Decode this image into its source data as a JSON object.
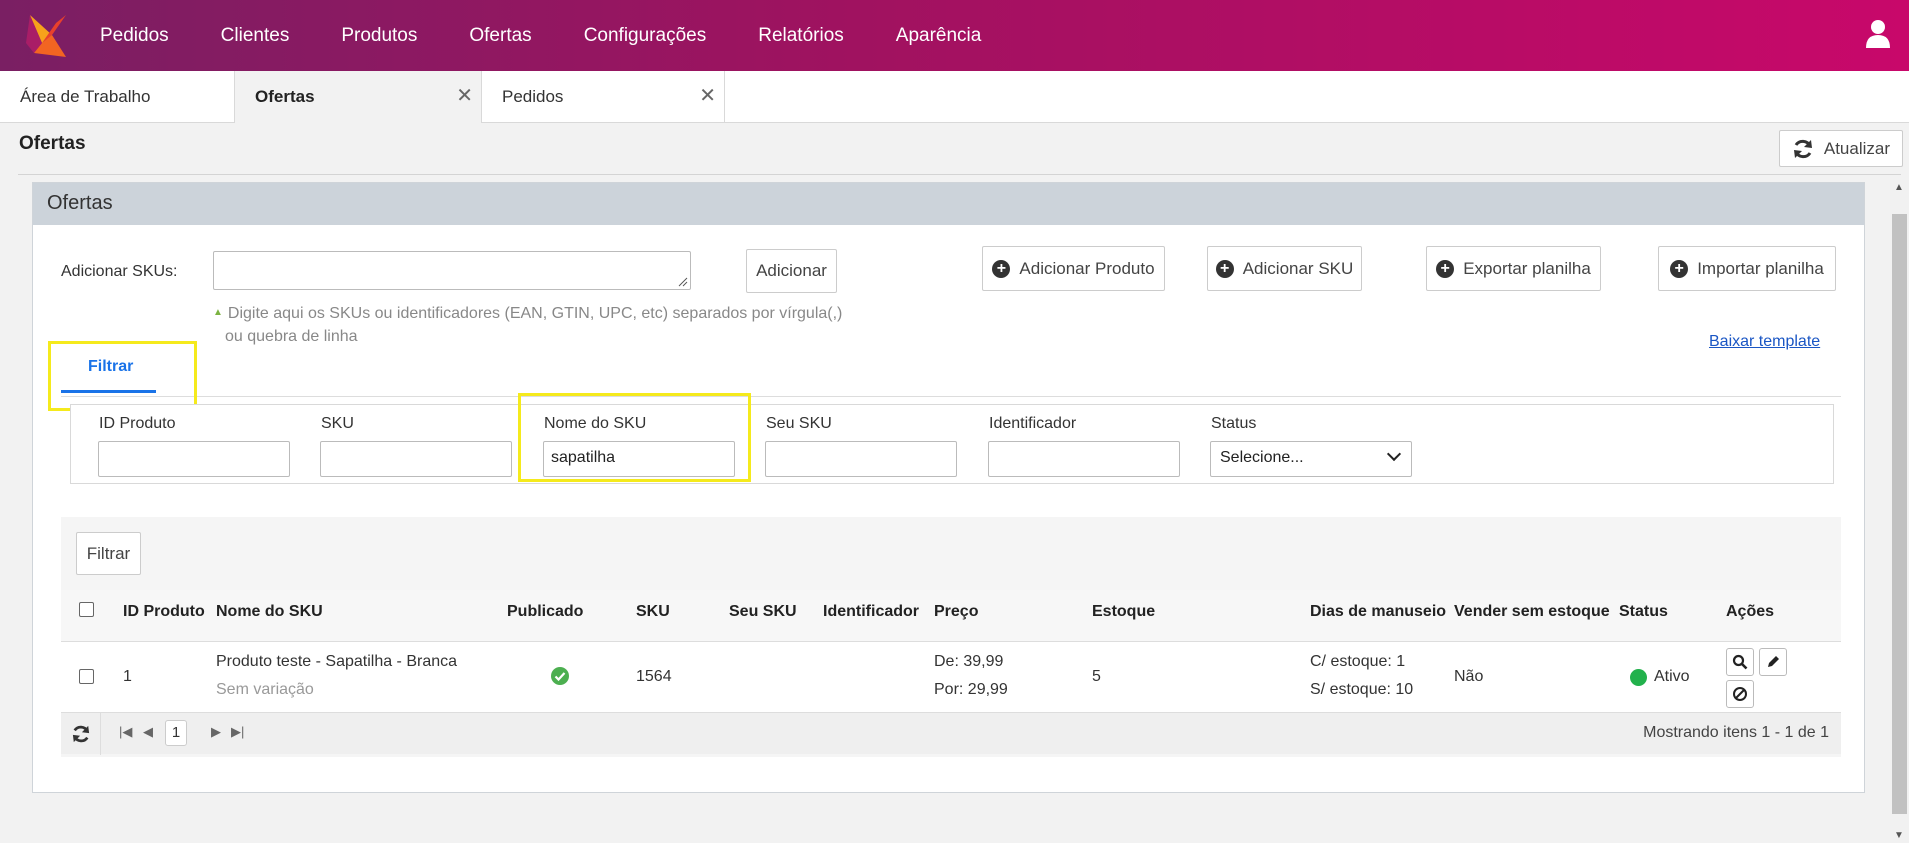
{
  "nav": {
    "items": [
      "Pedidos",
      "Clientes",
      "Produtos",
      "Ofertas",
      "Configurações",
      "Relatórios",
      "Aparência"
    ],
    "gradient": [
      "#7a1f63",
      "#c8086a"
    ]
  },
  "tabs": [
    {
      "label": "Área de Trabalho",
      "active": false
    },
    {
      "label": "Ofertas",
      "active": true
    },
    {
      "label": "Pedidos",
      "active": false
    }
  ],
  "page": {
    "title": "Ofertas",
    "refresh_label": "Atualizar"
  },
  "panel": {
    "title": "Ofertas",
    "add_skus_label": "Adicionar SKUs:",
    "add_button": "Adicionar",
    "hint_line1": "Digite aqui os SKUs ou identificadores (EAN, GTIN, UPC, etc) separados por vírgula(,)",
    "hint_line2": "ou quebra de linha",
    "actions": [
      "Adicionar Produto",
      "Adicionar SKU",
      "Exportar planilha",
      "Importar planilha"
    ],
    "template_link": "Baixar template"
  },
  "filter": {
    "tab_label": "Filtrar",
    "fields": [
      {
        "label": "ID Produto",
        "value": ""
      },
      {
        "label": "SKU",
        "value": ""
      },
      {
        "label": "Nome do SKU",
        "value": "sapatilha"
      },
      {
        "label": "Seu SKU",
        "value": ""
      },
      {
        "label": "Identificador",
        "value": ""
      }
    ],
    "status_label": "Status",
    "status_value": "Selecione...",
    "button": "Filtrar"
  },
  "table": {
    "headers": [
      "ID Produto",
      "Nome do SKU",
      "Publicado",
      "SKU",
      "Seu SKU",
      "Identificador",
      "Preço",
      "Estoque",
      "Dias de manuseio",
      "Vender sem estoque",
      "Status",
      "Ações"
    ],
    "rows": [
      {
        "id": "1",
        "name": "Produto teste - Sapatilha - Branca",
        "variation": "Sem variação",
        "sku": "1564",
        "price_de": "De: 39,99",
        "price_por": "Por: 29,99",
        "stock": "5",
        "days_with": "C/ estoque: 1",
        "days_without": "S/ estoque: 10",
        "sell_without_stock": "Não",
        "status": "Ativo",
        "status_color": "#22b14c"
      }
    ]
  },
  "pager": {
    "page": "1",
    "summary": "Mostrando itens 1 - 1 de 1"
  },
  "colors": {
    "accent": "#1a73e8",
    "highlight": "#f5ea1c",
    "panel_header": "#ccd3da"
  }
}
